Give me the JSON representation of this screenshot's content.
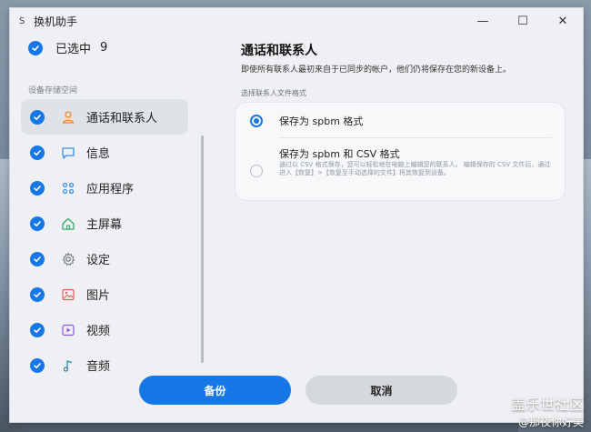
{
  "window": {
    "app_icon_text": "S",
    "title": "换机助手",
    "minimize": "—",
    "maximize": "☐",
    "close": "✕"
  },
  "sidebar": {
    "selected_label": "已选中",
    "selected_count": "9",
    "section_label": "设备存储空间",
    "items": [
      {
        "label": "通话和联系人",
        "icon": "person-icon",
        "active": true
      },
      {
        "label": "信息",
        "icon": "message-icon"
      },
      {
        "label": "应用程序",
        "icon": "apps-icon"
      },
      {
        "label": "主屏幕",
        "icon": "home-icon"
      },
      {
        "label": "设定",
        "icon": "gear-icon"
      },
      {
        "label": "图片",
        "icon": "image-icon"
      },
      {
        "label": "视频",
        "icon": "video-icon"
      },
      {
        "label": "音频",
        "icon": "music-icon"
      }
    ]
  },
  "main": {
    "title": "通话和联系人",
    "description": "即使所有联系人最初来自于已同步的帐户，他们仍将保存在您的新设备上。",
    "format_label": "选择联系人文件格式",
    "options": [
      {
        "label": "保存为 spbm 格式",
        "selected": true
      },
      {
        "label": "保存为 spbm 和 CSV 格式",
        "description": "通过以 CSV 格式保存，您可以轻松地在电脑上编辑您的联系人。 编辑保存的 CSV 文件后，通过进入【恢复】>【恢复至手动选择的文件】将其恢复到设备。",
        "selected": false
      }
    ]
  },
  "buttons": {
    "backup": "备份",
    "cancel": "取消"
  },
  "watermark": {
    "line1": "盖乐世社区",
    "line2": "@那夜你好美"
  },
  "colors": {
    "accent": "#1677e6",
    "icon_orange": "#e8893a",
    "icon_blue": "#3a8ee6",
    "icon_green": "#3aa86a",
    "icon_gray": "#6d7278",
    "icon_red": "#e0605a",
    "icon_purple": "#8a5ad6",
    "icon_teal": "#2e8a9a"
  }
}
